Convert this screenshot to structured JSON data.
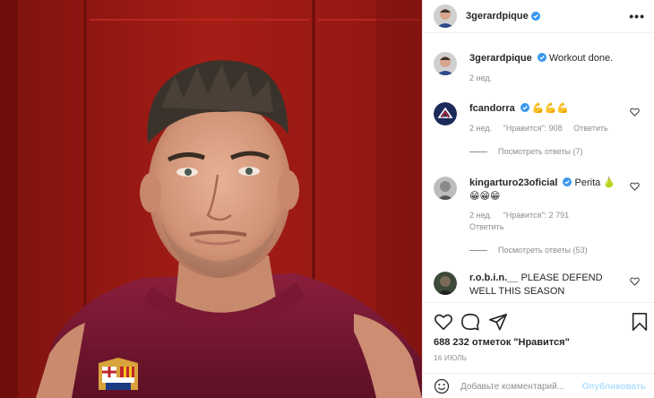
{
  "post": {
    "author": "3gerardpique",
    "caption": "Workout done.",
    "caption_age": "2 нед."
  },
  "header": {
    "username": "3gerardpique",
    "more_icon": "more-horizontal-icon"
  },
  "comments": [
    {
      "username": "fcandorra",
      "text": "💪💪💪",
      "age": "2 нед.",
      "likes_text": "\"Нравится\": 908",
      "reply_label": "Ответить",
      "replies_label": "Посмотреть ответы (7)"
    },
    {
      "username": "kingarturo23oficial",
      "text": "Perita 🍐",
      "text2": "😁😁😁",
      "age": "2 нед.",
      "likes_text": "\"Нравится\": 2 791",
      "reply_label": "Ответить",
      "replies_label": "Посмотреть ответы (53)"
    },
    {
      "username": "r.o.b.i.n.__",
      "text": "PLEASE DEFEND WELL THIS SEASON"
    }
  ],
  "actions": {
    "likes_count": "688 232 отметок \"Нравится\"",
    "date": "16 ИЮЛЬ",
    "comment_placeholder": "Добавьте комментарий...",
    "publish_label": "Опубликовать"
  },
  "colors": {
    "brand_blue": "#0095f6",
    "publish_disabled": "#b2dffc",
    "verified": "#3897f0",
    "wall_red": "#9a1a14"
  }
}
